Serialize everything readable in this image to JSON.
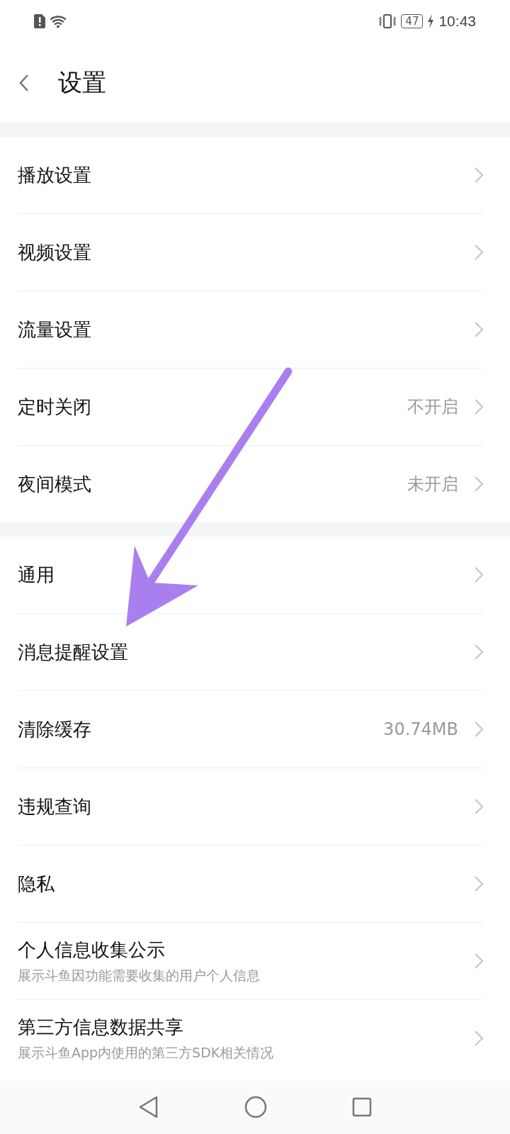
{
  "status_bar": {
    "battery": "47",
    "time": "10:43"
  },
  "header": {
    "title": "设置"
  },
  "sections": [
    {
      "items": [
        {
          "label": "播放设置"
        },
        {
          "label": "视频设置"
        },
        {
          "label": "流量设置"
        },
        {
          "label": "定时关闭",
          "value": "不开启"
        },
        {
          "label": "夜间模式",
          "value": "未开启"
        }
      ]
    },
    {
      "items": [
        {
          "label": "通用"
        },
        {
          "label": "消息提醒设置"
        },
        {
          "label": "清除缓存",
          "value": "30.74MB"
        },
        {
          "label": "违规查询"
        },
        {
          "label": "隐私"
        },
        {
          "label": "个人信息收集公示",
          "subtitle": "展示斗鱼因功能需要收集的用户个人信息"
        },
        {
          "label": "第三方信息数据共享",
          "subtitle": "展示斗鱼App内使用的第三方SDK相关情况"
        }
      ]
    }
  ]
}
